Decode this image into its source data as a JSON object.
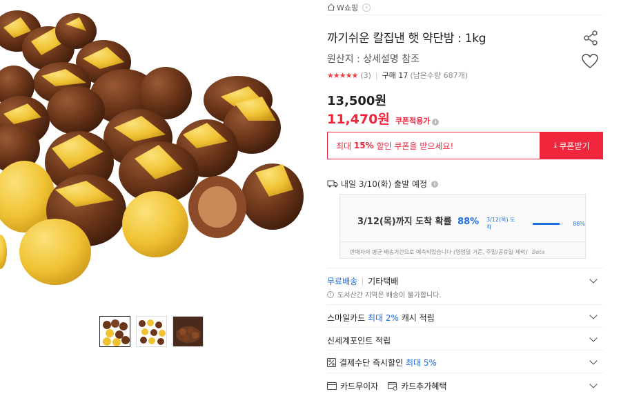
{
  "breadcrumb": {
    "store": "W쇼핑"
  },
  "product": {
    "title": "까기쉬운 칼집낸 햇 약단밤 : 1kg",
    "origin": "원산지 : 상세설명 참조",
    "rating_stars": "★★★★★",
    "review_count": "(3)",
    "purchase": "구매 17",
    "stock": "(남은수량 687개)",
    "original_price": "13,500원",
    "sale_price": "11,470원",
    "coupon_applied": "쿠폰적용가",
    "icons": [
      "home-icon",
      "share-icon",
      "heart-icon",
      "info-icon",
      "truck-icon",
      "download-icon",
      "percent-icon",
      "card-icon"
    ]
  },
  "coupon": {
    "prefix": "최대 ",
    "pct": "15%",
    "suffix": " 할인 쿠폰을 받으세요!",
    "button": "쿠폰받기"
  },
  "shipping": {
    "departure": "내일 3/10(화) 출발 예정",
    "predict_main": "3/12(목)까지 도착 확률",
    "predict_pct": "88%",
    "predict_mini_label": "3/12(목) 도착",
    "predict_mini_pct": "88%",
    "predict_fraction": 0.88,
    "note": "판매자의 평균 배송기간으로 예측되었습니다 (영업일 기준, 주말/공휴일 제외)",
    "beta": "Beta"
  },
  "rows": {
    "free_shipping": "무료배송",
    "courier": "기타택배",
    "island_note": "도서산간 지역은 배송이 불가합니다.",
    "smile_prefix": "스마일카드 ",
    "smile_highlight": "최대 2%",
    "smile_suffix": " 캐시 적립",
    "ssg_point": "신세계포인트 적립",
    "instant_prefix": "결제수단 즉시할인 ",
    "instant_highlight": "최대 5%",
    "card_interest": "카드무이자",
    "card_benefit": "카드추가혜택"
  },
  "colors": {
    "accent_red": "#f0263c",
    "accent_blue": "#1f6fe0"
  }
}
